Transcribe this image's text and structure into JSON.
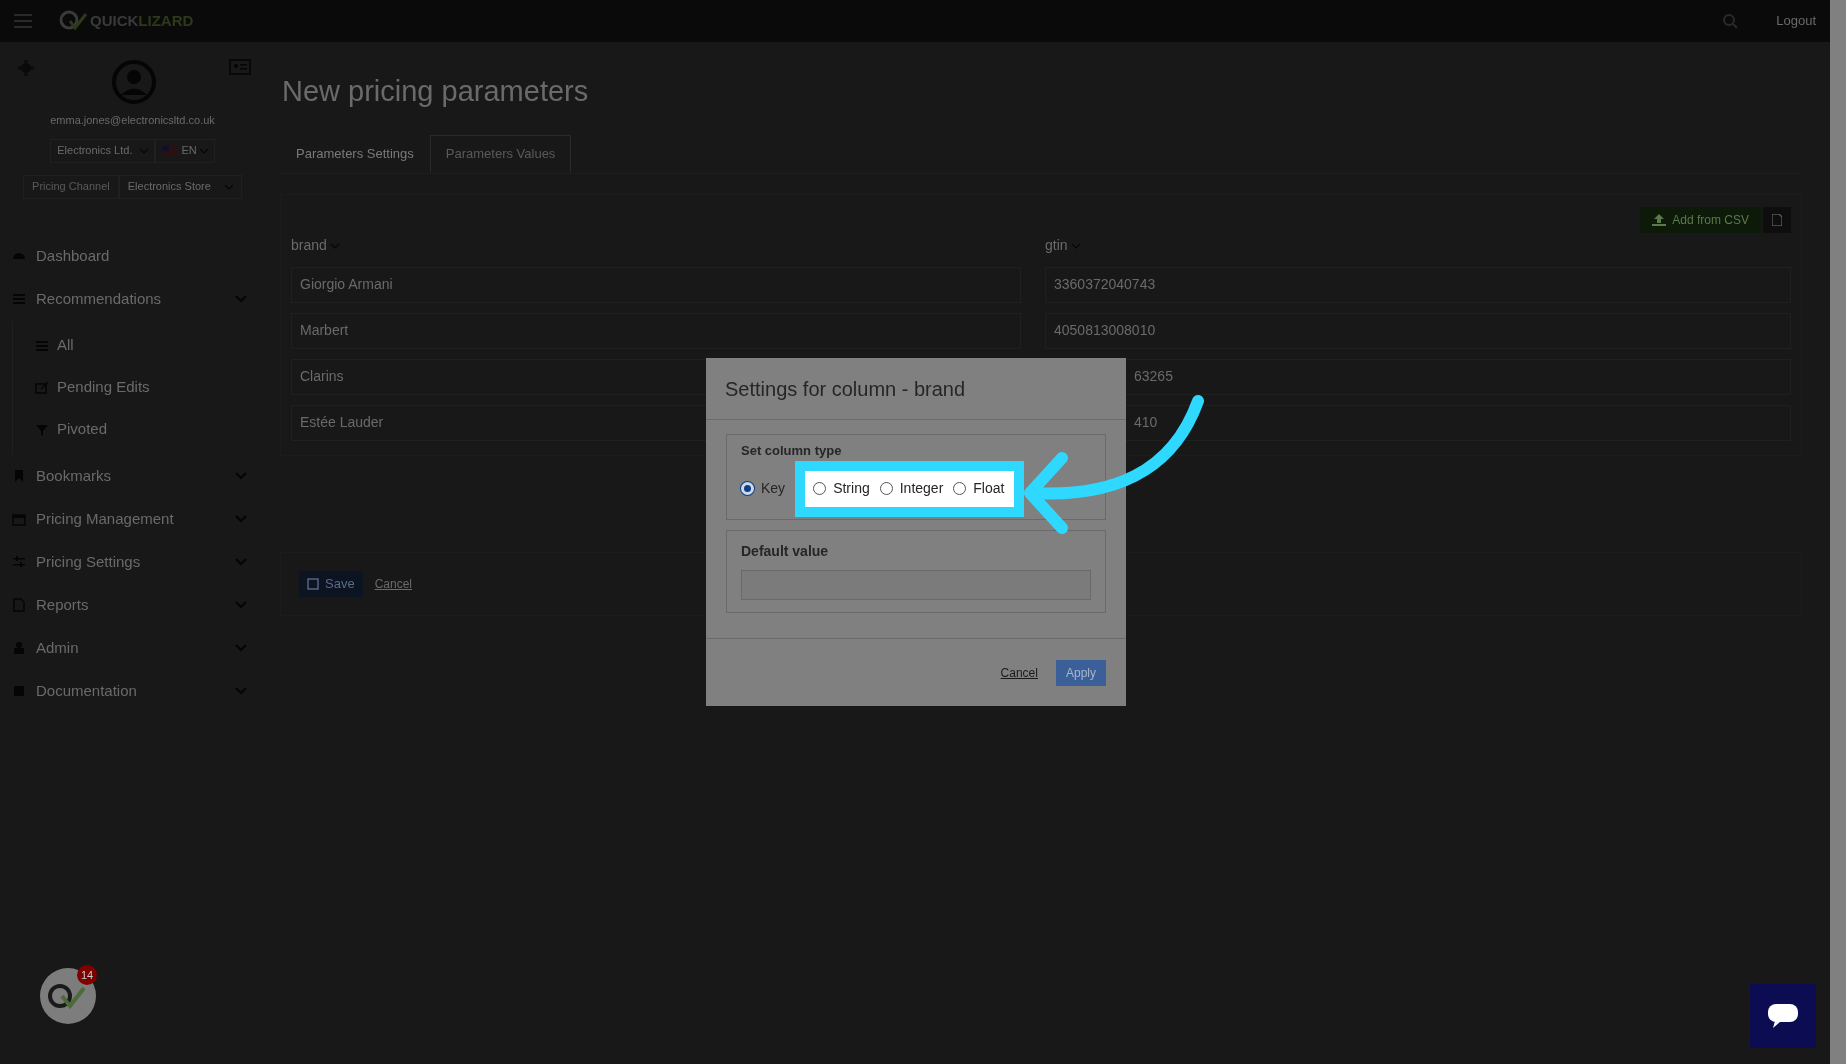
{
  "top_bar": {
    "logo": {
      "first": "QUICK",
      "second": "LIZARD"
    },
    "logout": "Logout"
  },
  "sidebar": {
    "email": "emma.jones@electronicsltd.co.uk",
    "company": "Electronics Ltd.",
    "language": "EN",
    "channel_label": "Pricing Channel",
    "channel": "Electronics Store",
    "items": [
      {
        "label": "Dashboard",
        "kind": "link"
      },
      {
        "label": "Recommendations",
        "kind": "group",
        "children": [
          {
            "label": "All"
          },
          {
            "label": "Pending Edits"
          },
          {
            "label": "Pivoted"
          }
        ]
      },
      {
        "label": "Bookmarks",
        "kind": "group"
      },
      {
        "label": "Pricing Management",
        "kind": "group"
      },
      {
        "label": "Pricing Settings",
        "kind": "group"
      },
      {
        "label": "Reports",
        "kind": "group"
      },
      {
        "label": "Admin",
        "kind": "group"
      },
      {
        "label": "Documentation",
        "kind": "group"
      }
    ]
  },
  "page": {
    "title": "New pricing parameters",
    "tabs": [
      {
        "label": "Parameters Settings",
        "selected": false
      },
      {
        "label": "Parameters Values",
        "selected": true
      }
    ],
    "add_button": "Add from CSV",
    "table": {
      "columns": [
        "brand",
        "gtin"
      ],
      "rows": [
        {
          "cells": [
            {
              "value": "Giorgio Armani"
            },
            {
              "value": "3360372040743"
            }
          ]
        },
        {
          "cells": [
            {
              "value": "Marbert"
            },
            {
              "value": "4050813008010"
            }
          ]
        },
        {
          "cells": [
            {
              "value": "Clarins"
            },
            {
              "value": "63265",
              "clipped": true
            }
          ]
        },
        {
          "cells": [
            {
              "value": "Estée Lauder"
            },
            {
              "value": "410",
              "clipped": true
            }
          ]
        }
      ]
    },
    "save": "Save",
    "cancel": "Cancel"
  },
  "dialog": {
    "title": "Settings for column - brand",
    "type_label": "Set column type",
    "options": [
      {
        "label": "Key",
        "selected": true,
        "highlighted": false
      },
      {
        "label": "String",
        "selected": false,
        "highlighted": true
      },
      {
        "label": "Integer",
        "selected": false,
        "highlighted": true
      },
      {
        "label": "Float",
        "selected": false,
        "highlighted": true
      }
    ],
    "default_label": "Default value",
    "cancel": "Cancel",
    "apply": "Apply"
  },
  "chat_badge": "14"
}
